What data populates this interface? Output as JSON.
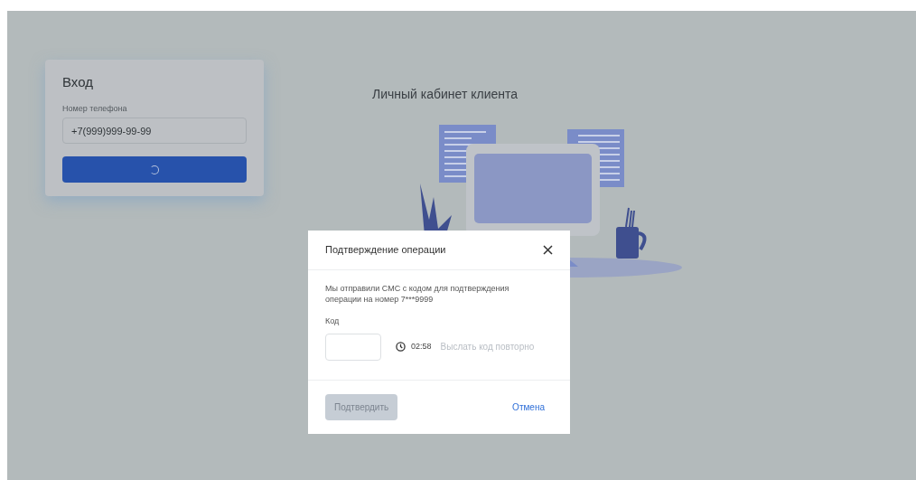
{
  "login_card": {
    "title": "Вход",
    "phone_label": "Номер телефона",
    "phone_value": "+7(999)999-99-99",
    "submit": {
      "loading": true
    }
  },
  "heading": "Личный кабинет клиента",
  "dialog": {
    "title": "Подтверждение операции",
    "message": "Мы отправили СМС с кодом для подтверждения операции на номер 7***9999",
    "code_label": "Код",
    "timer": "02:58",
    "resend": {
      "label": "Выслать код повторно",
      "disabled": true
    },
    "confirm": {
      "label": "Подтвердить",
      "disabled": true
    },
    "cancel": "Отмена"
  }
}
